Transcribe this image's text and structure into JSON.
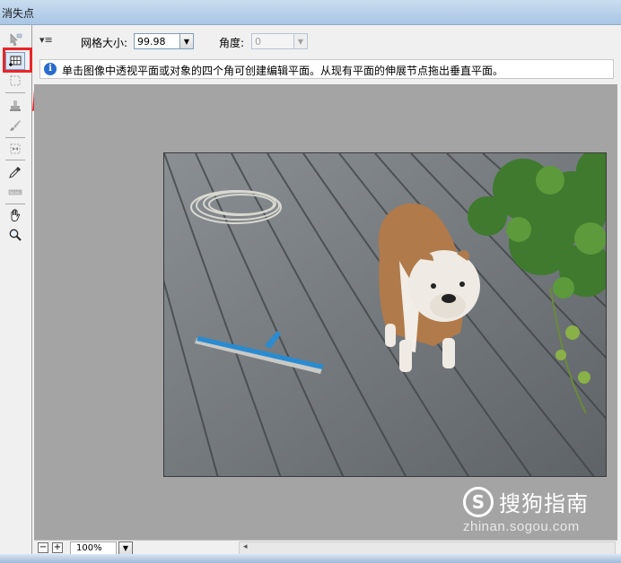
{
  "window": {
    "title": "消失点"
  },
  "tools": [
    {
      "name": "edit-plane-tool-icon",
      "active": false
    },
    {
      "name": "create-plane-tool-icon",
      "active": true
    },
    {
      "name": "marquee-tool-icon",
      "active": false
    },
    {
      "name": "stamp-tool-icon",
      "active": false
    },
    {
      "name": "brush-tool-icon",
      "active": false
    },
    {
      "name": "transform-tool-icon",
      "active": false
    },
    {
      "name": "eyedropper-tool-icon",
      "active": false
    },
    {
      "name": "measure-tool-icon",
      "active": false
    },
    {
      "name": "hand-tool-icon",
      "active": false
    },
    {
      "name": "zoom-tool-icon",
      "active": false
    }
  ],
  "options": {
    "menu_glyph": "▾≡",
    "grid_size_label": "网格大小:",
    "grid_size_value": "99.98",
    "angle_label": "角度:",
    "angle_value": "0"
  },
  "info": {
    "icon_glyph": "i",
    "text": "单击图像中透视平面或对象的四个角可创建编辑平面。从现有平面的伸展节点拖出垂直平面。"
  },
  "status": {
    "zoom_out_glyph": "−",
    "zoom_in_glyph": "+",
    "zoom_value": "100%",
    "scroll_left_glyph": "◂"
  },
  "watermark": {
    "logo_glyph": "S",
    "brand": "搜狗指南",
    "url": "zhinan.sogou.com"
  },
  "colors": {
    "highlight": "#e8262a",
    "canvas": "#a4a4a4",
    "info_icon": "#2a6ccd"
  }
}
